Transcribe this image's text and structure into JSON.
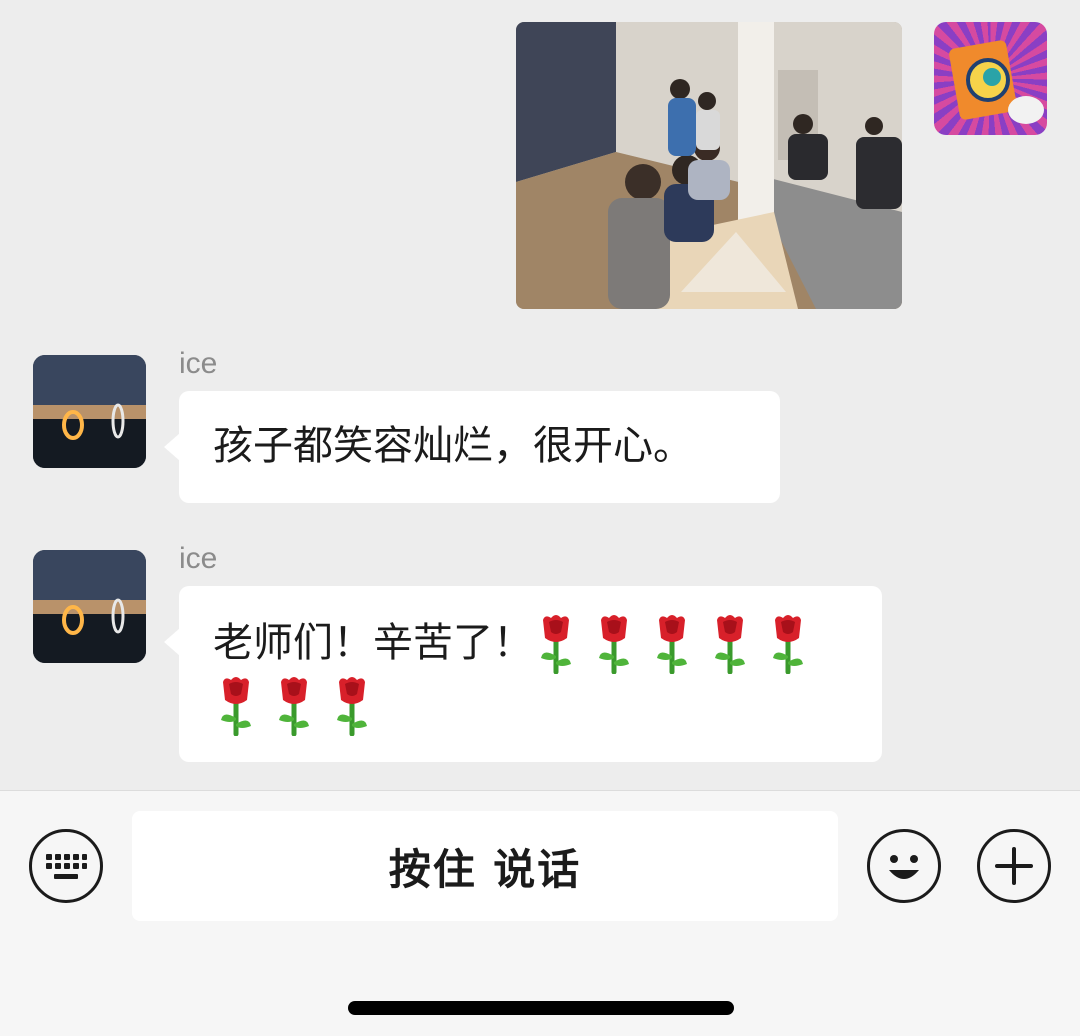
{
  "messages": [
    {
      "type": "image",
      "from": "self",
      "content": "classroom photo"
    },
    {
      "type": "text",
      "from": "other",
      "sender": "ice",
      "text": "孩子都笑容灿烂，很开心。"
    },
    {
      "type": "text",
      "from": "other",
      "sender": "ice",
      "text": "老师们！辛苦了！",
      "emoji": "rose",
      "emoji_count": 8
    }
  ],
  "input_bar": {
    "voice_button_label": "按住 说话",
    "left_icon": "keyboard-icon",
    "right_icons": [
      "emoji-icon",
      "plus-icon"
    ]
  },
  "colors": {
    "background": "#ededed",
    "bubble": "#ffffff",
    "name_text": "#8b8b8b",
    "input_bar": "#f6f6f6"
  }
}
